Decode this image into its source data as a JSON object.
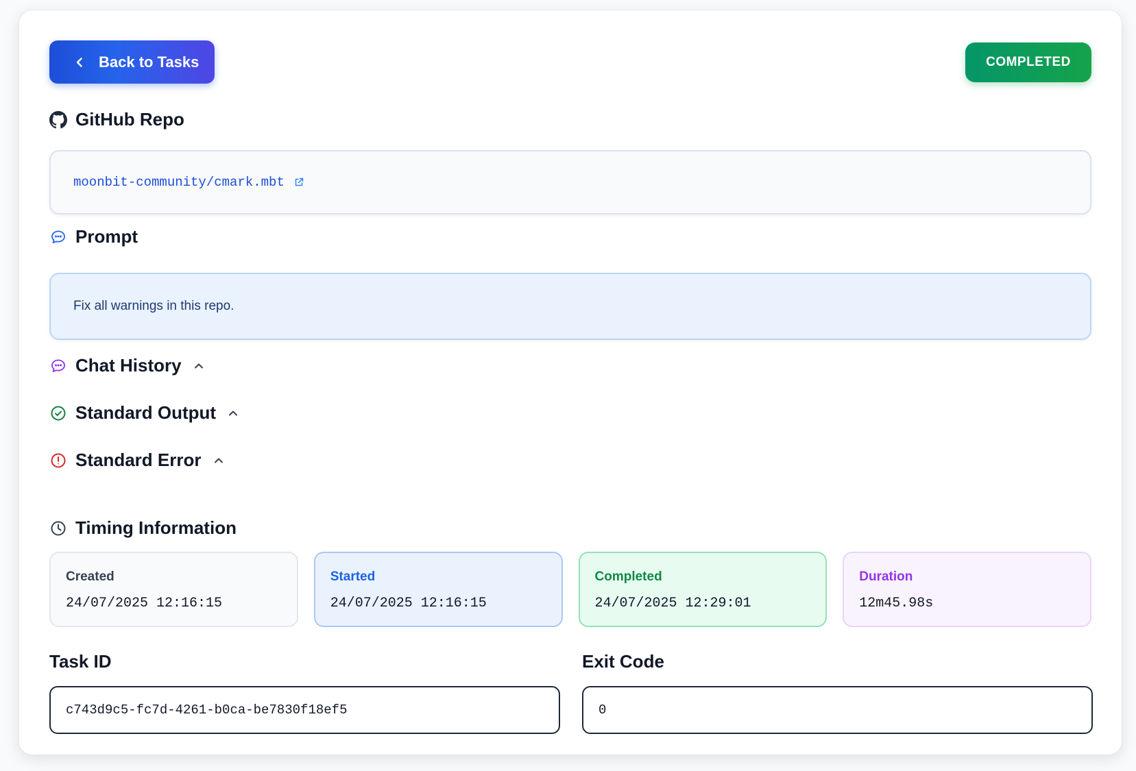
{
  "header": {
    "back_label": "Back to Tasks",
    "status": "COMPLETED",
    "status_color": "#16a34a",
    "accent": "#2563eb"
  },
  "repo": {
    "title": "GitHub Repo",
    "name": "moonbit-community/cmark.mbt",
    "icon": "github-icon",
    "link_icon": "external-link-icon"
  },
  "prompt": {
    "title": "Prompt",
    "text": "Fix all warnings in this repo.",
    "icon": "chat-bubble-icon"
  },
  "sections": {
    "chat_history": "Chat History",
    "standard_output": "Standard Output",
    "standard_error": "Standard Error",
    "timing": "Timing Information"
  },
  "timing": {
    "created_label": "Created",
    "created_value": "24/07/2025 12:16:15",
    "started_label": "Started",
    "started_value": "24/07/2025 12:16:15",
    "completed_label": "Completed",
    "completed_value": "24/07/2025 12:29:01",
    "duration_label": "Duration",
    "duration_value": "12m45.98s"
  },
  "fields": {
    "task_id_label": "Task ID",
    "task_id_value": "c743d9c5-fc7d-4261-b0ca-be7830f18ef5",
    "exit_code_label": "Exit Code",
    "exit_code_value": "0"
  }
}
